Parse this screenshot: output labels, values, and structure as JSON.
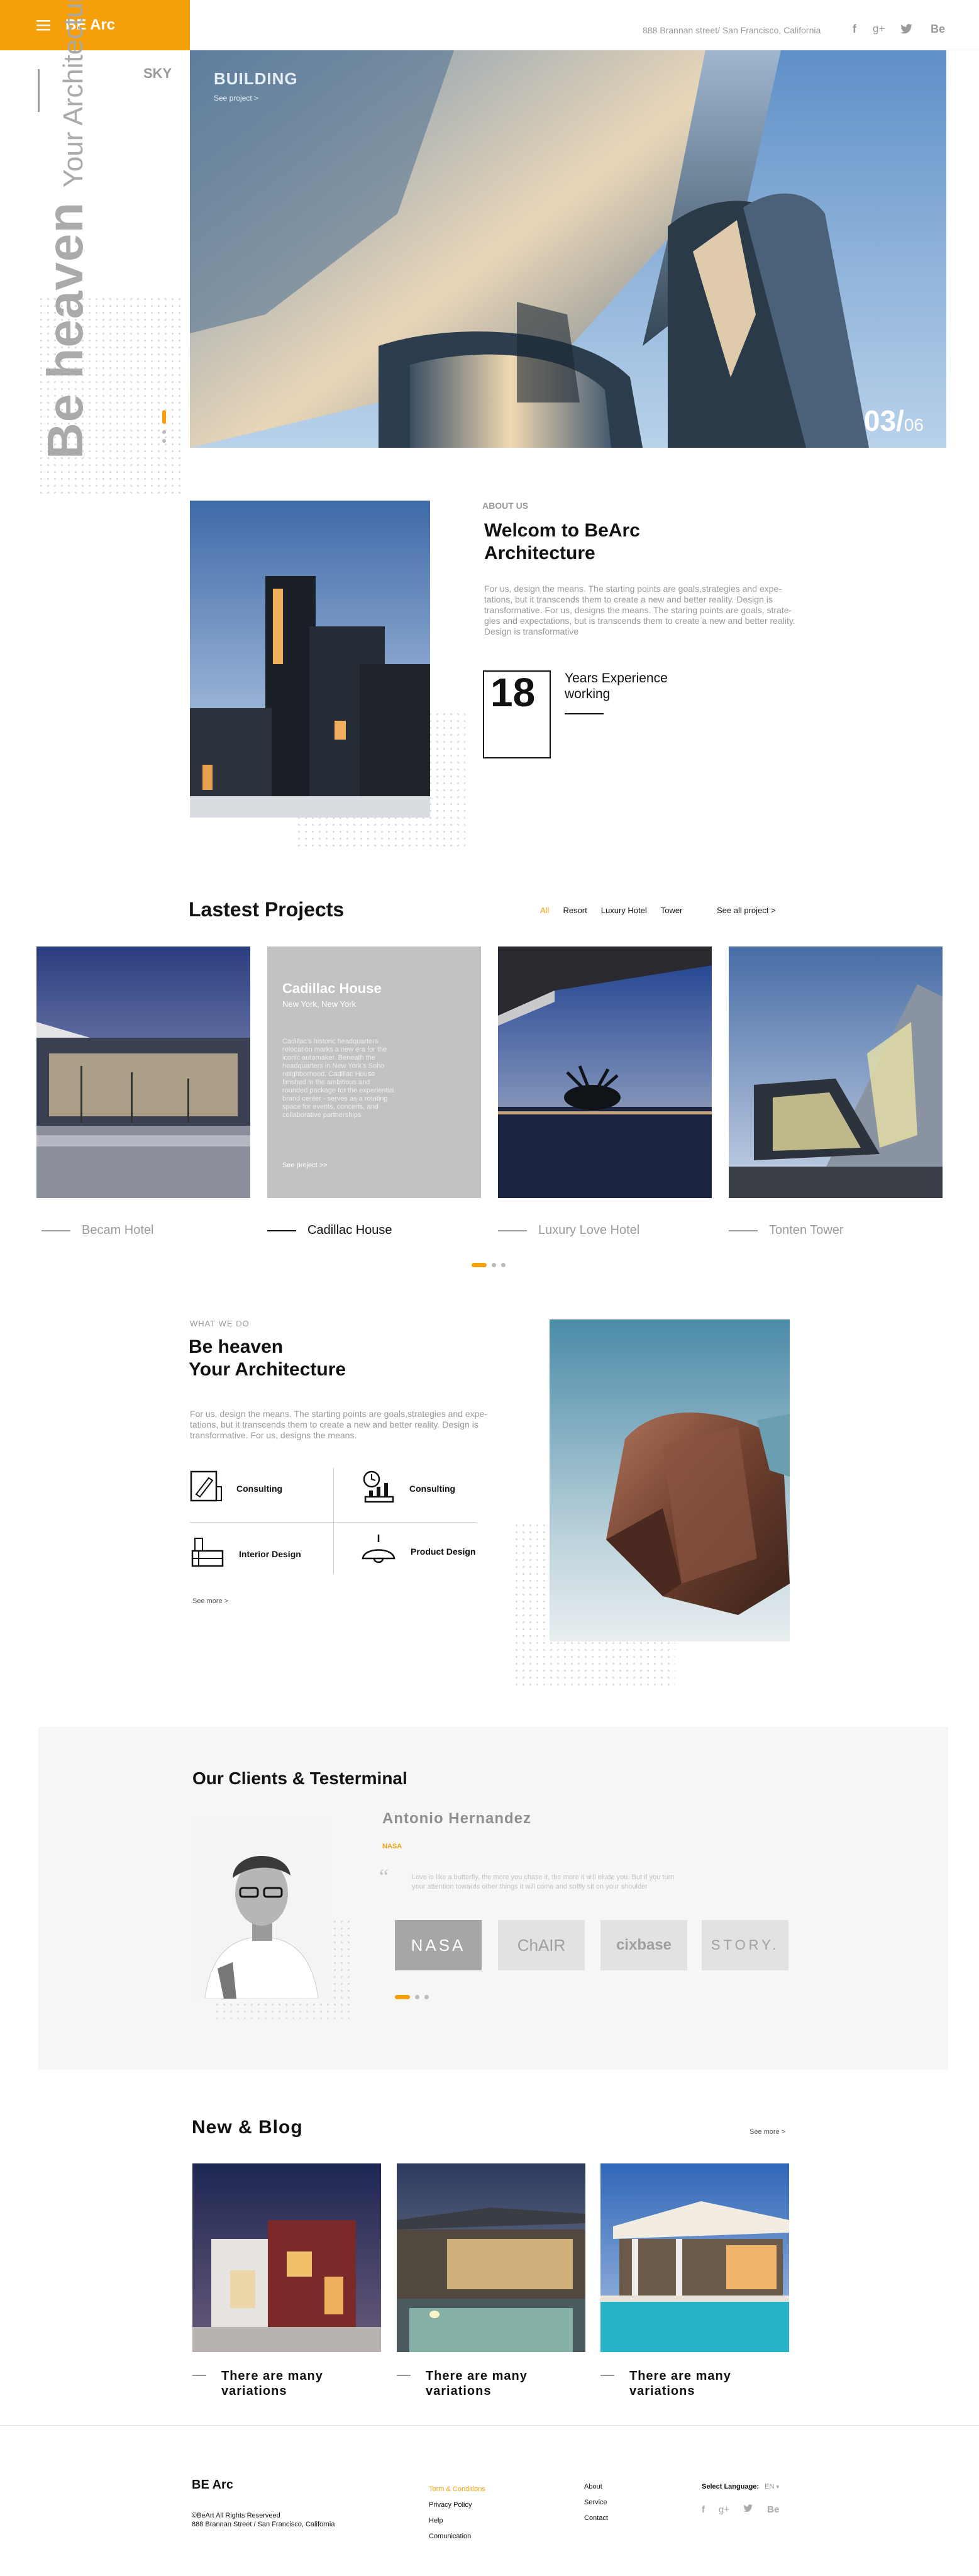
{
  "header": {
    "brand": "BE Arc",
    "address": "888 Brannan street/ San Francisco, California",
    "social": [
      "f",
      "g+",
      "t",
      "Be"
    ],
    "social_icons": [
      "facebook-icon",
      "google-plus-icon",
      "twitter-icon",
      "behance-icon"
    ]
  },
  "hero": {
    "side_label": "SKY",
    "vertical_big": "Be heaven",
    "vertical_small": "Your Architecture",
    "slide_title": "BUILDING",
    "slide_link": "See project >",
    "counter_current": "03/",
    "counter_total": "06"
  },
  "about": {
    "eyebrow": "ABOUT US",
    "title_line1": "Welcom to BeArc",
    "title_line2": "Architecture",
    "body": "For us, design the means. The starting points are goals,strategies and expe-tations, but it transcends them to create a new and better reality. Design is transformative. For us, designs the means. The staring points are goals, strate-gies and expectations, but is transcends them to create a new and better reality. Design is transformative",
    "years_number": "18",
    "years_line1": "Years Experience",
    "years_line2": "working"
  },
  "projects": {
    "title": "Lastest Projects",
    "filters": [
      "All",
      "Resort",
      "Luxury Hotel",
      "Tower"
    ],
    "see_all": "See all project  >",
    "featured_title": "Cadillac House",
    "featured_subtitle": "New York, New York",
    "featured_body": "Cadillac's historic headquarters relocation marks a new era for the iconic automaker. Beneath the headquarters in New York's Soho neighborhood, Cadillac House finished in the ambitious and rounded package for the experiential brand center - serves as a rotating space for events, concerts, and collaborative partnerships",
    "featured_link": "See project >>",
    "items": [
      "Becam Hotel",
      "Cadillac House",
      "Luxury Love Hotel",
      "Tonten Tower"
    ]
  },
  "whatwedo": {
    "eyebrow": "WHAT WE DO",
    "title_line1": "Be heaven",
    "title_line2": "Your Architecture",
    "body": "For us, design the means. The starting points are goals,strategies and expe-tations, but it transcends them to create a new and better reality. Design is transformative. For us, designs the means.",
    "services": [
      "Consulting",
      "Consulting",
      "Interior Design",
      "Product Design"
    ],
    "see_more": "See more >"
  },
  "clients": {
    "title": "Our Clients & Testerminal",
    "person": "Antonio Hernandez",
    "company": "NASA",
    "quote": "Love is like a butterfly, the more you chase it, the more it will elude you. But if you turn your attention towards other things it will come and softly sit on your shoulder",
    "logos": [
      "NASA",
      "ChAIR",
      "cixbase",
      "STORY."
    ]
  },
  "blog": {
    "title": "New & Blog",
    "see_more": "See more >",
    "posts": [
      "There are many variations",
      "There are many variations",
      "There are many variations"
    ]
  },
  "footer": {
    "brand": "BE Arc",
    "copyright": "©BeArt All Rights Reserveed",
    "address": "888 Brannan Street / San Francisco, California",
    "links_col1": [
      "Term & Conditions",
      "Privacy Policy",
      "Help",
      "Comunication"
    ],
    "links_col2": [
      "About",
      "Service",
      "Contact"
    ],
    "language_label": "Select Language:",
    "language_value": "EN",
    "social": [
      "f",
      "g+",
      "t",
      "Be"
    ]
  },
  "colors": {
    "accent": "#f5a00a",
    "gray": "#9a9a9a",
    "light_bg": "#f6f6f6"
  }
}
